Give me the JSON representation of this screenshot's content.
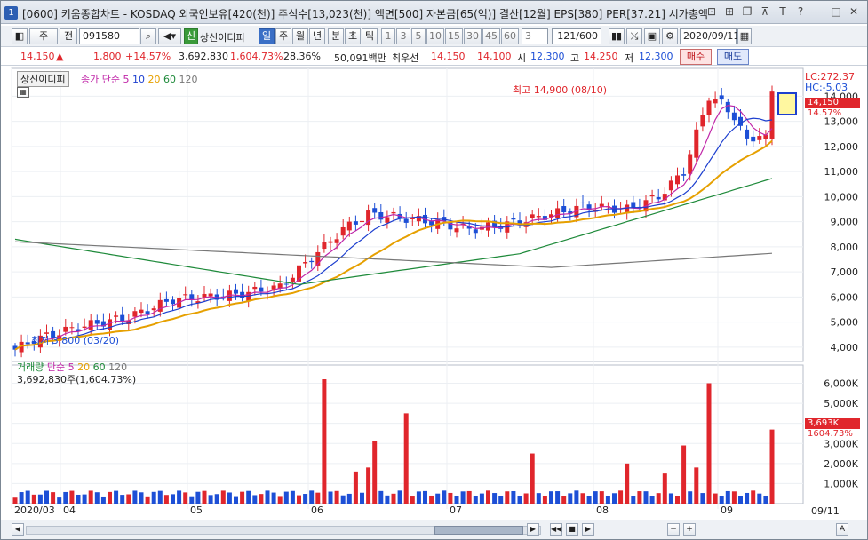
{
  "window": {
    "number": "1",
    "title": "[0600] 키움종합차트 - KOSDAQ 외국인보유[420(천)] 주식수[13,023(천)] 액면[500] 자본금[65(억)] 결산[12월] EPS[380] PER[37.21] 시가총액"
  },
  "toolbar": {
    "period": "주",
    "prev": "전",
    "code": "091580",
    "stock_name": "상신이디피",
    "sin": "신",
    "periods": [
      "일",
      "주",
      "월",
      "년",
      "분",
      "초",
      "틱"
    ],
    "intervals": [
      "1",
      "3",
      "5",
      "10",
      "15",
      "30",
      "45",
      "60"
    ],
    "custom_interval": "3",
    "count": "121/600",
    "date": "2020/09/11"
  },
  "quote": {
    "price": "14,150",
    "arrow": "▲",
    "change": "1,800",
    "change_pct": "+14.57%",
    "volume": "3,692,830",
    "vol_pct": "1,604.73%",
    "turnover": "28.36%",
    "amount": "50,091백만",
    "priority": "최우선",
    "ask": "14,150",
    "bid": "14,100",
    "open_label": "시",
    "open": "12,300",
    "high_label": "고",
    "high": "14,250",
    "low_label": "저",
    "low": "12,300",
    "buy": "매수",
    "sell": "매도"
  },
  "price_panel": {
    "name": "상신이디피",
    "legend_prefix": "종가 단순",
    "ma": [
      {
        "p": "5",
        "c": "#c026a8"
      },
      {
        "p": "10",
        "c": "#1d3fcf"
      },
      {
        "p": "20",
        "c": "#e6a000"
      },
      {
        "p": "60",
        "c": "#1e8a3a"
      },
      {
        "p": "120",
        "c": "#777777"
      }
    ],
    "lc": "LC:272.37",
    "hc": "HC:-5.03",
    "last": "14,150",
    "last_pct": "14.57%",
    "high_note": "최고 14,900 (08/10)",
    "low_note": "최저 3,800 (03/20)",
    "yticks": [
      "14,000",
      "13,000",
      "12,000",
      "11,000",
      "10,000",
      "9,000",
      "8,000",
      "7,000",
      "6,000",
      "5,000",
      "4,000"
    ]
  },
  "volume_panel": {
    "legend_prefix": "거래량",
    "legend_ma": "단순",
    "ma": [
      {
        "p": "5",
        "c": "#c026a8"
      },
      {
        "p": "20",
        "c": "#e6a000"
      },
      {
        "p": "60",
        "c": "#1e8a3a"
      },
      {
        "p": "120",
        "c": "#777777"
      }
    ],
    "value": "3,692,830주(1,604.73%)",
    "last": "3,693K",
    "last_pct": "1604.73%",
    "yticks": [
      "6,000K",
      "5,000K",
      "4,000K",
      "3,000K",
      "2,000K",
      "1,000K"
    ]
  },
  "xaxis": {
    "labels": [
      "2020/03",
      "04",
      "05",
      "06",
      "07",
      "08",
      "09"
    ],
    "end": "09/11"
  },
  "colors": {
    "up": "#e0262c",
    "down": "#1d4fd6"
  },
  "chart_data": {
    "type": "candlestick",
    "categories": [
      "2020/03",
      "04",
      "05",
      "06",
      "07",
      "08",
      "09"
    ],
    "ohlc_close_start": 3800,
    "ohlc_close_peak": 14900,
    "last_close": 14150,
    "y_price_range": [
      3500,
      14900
    ],
    "y_volume_range": [
      0,
      6200000
    ]
  }
}
